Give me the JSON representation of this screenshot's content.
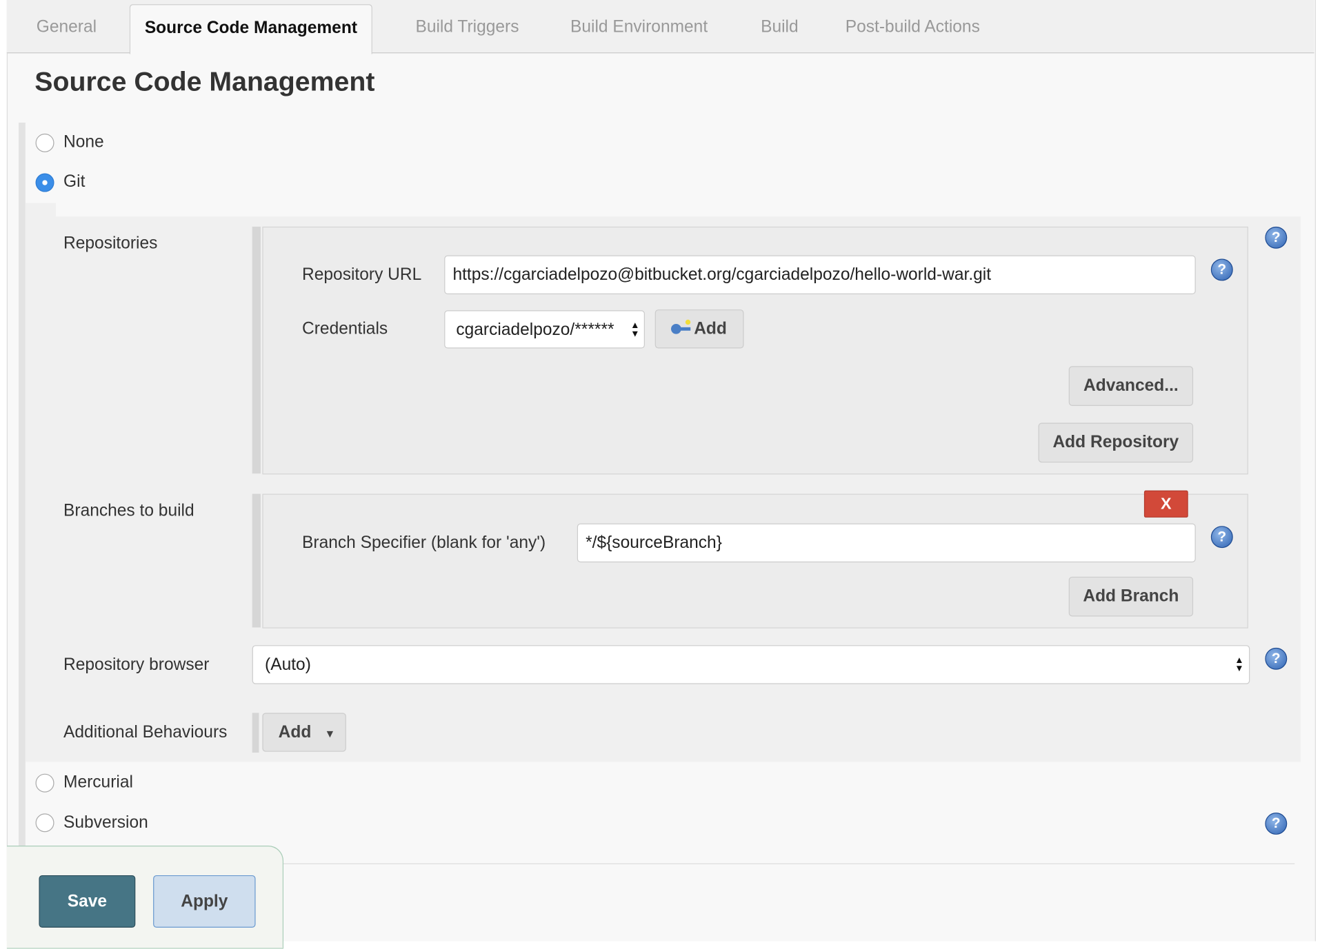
{
  "tabs": [
    {
      "label": "General",
      "active": false
    },
    {
      "label": "Source Code Management",
      "active": true
    },
    {
      "label": "Build Triggers",
      "active": false
    },
    {
      "label": "Build Environment",
      "active": false
    },
    {
      "label": "Build",
      "active": false
    },
    {
      "label": "Post-build Actions",
      "active": false
    }
  ],
  "section_title": "Source Code Management",
  "scm_options": {
    "none": "None",
    "git": "Git",
    "mercurial": "Mercurial",
    "subversion": "Subversion",
    "selected": "Git"
  },
  "git": {
    "repositories_label": "Repositories",
    "repo_url_label": "Repository URL",
    "repo_url_value": "https://cgarciadelpozo@bitbucket.org/cgarciadelpozo/hello-world-war.git",
    "credentials_label": "Credentials",
    "credentials_value": "cgarciadelpozo/******",
    "add_credentials_label": "Add",
    "advanced_label": "Advanced...",
    "add_repository_label": "Add Repository",
    "branches_label": "Branches to build",
    "delete_branch_label": "X",
    "branch_specifier_label": "Branch Specifier (blank for 'any')",
    "branch_specifier_value": "*/${sourceBranch}",
    "add_branch_label": "Add Branch",
    "repo_browser_label": "Repository browser",
    "repo_browser_value": "(Auto)",
    "additional_behaviours_label": "Additional Behaviours",
    "add_behaviour_label": "Add"
  },
  "footer": {
    "save_label": "Save",
    "apply_label": "Apply"
  },
  "icons": {
    "help": "help-icon",
    "key": "key-icon"
  },
  "colors": {
    "save": "#467585",
    "apply": "#cfdeee",
    "delete": "#d24939",
    "radio_selected": "#3b8ee8"
  }
}
